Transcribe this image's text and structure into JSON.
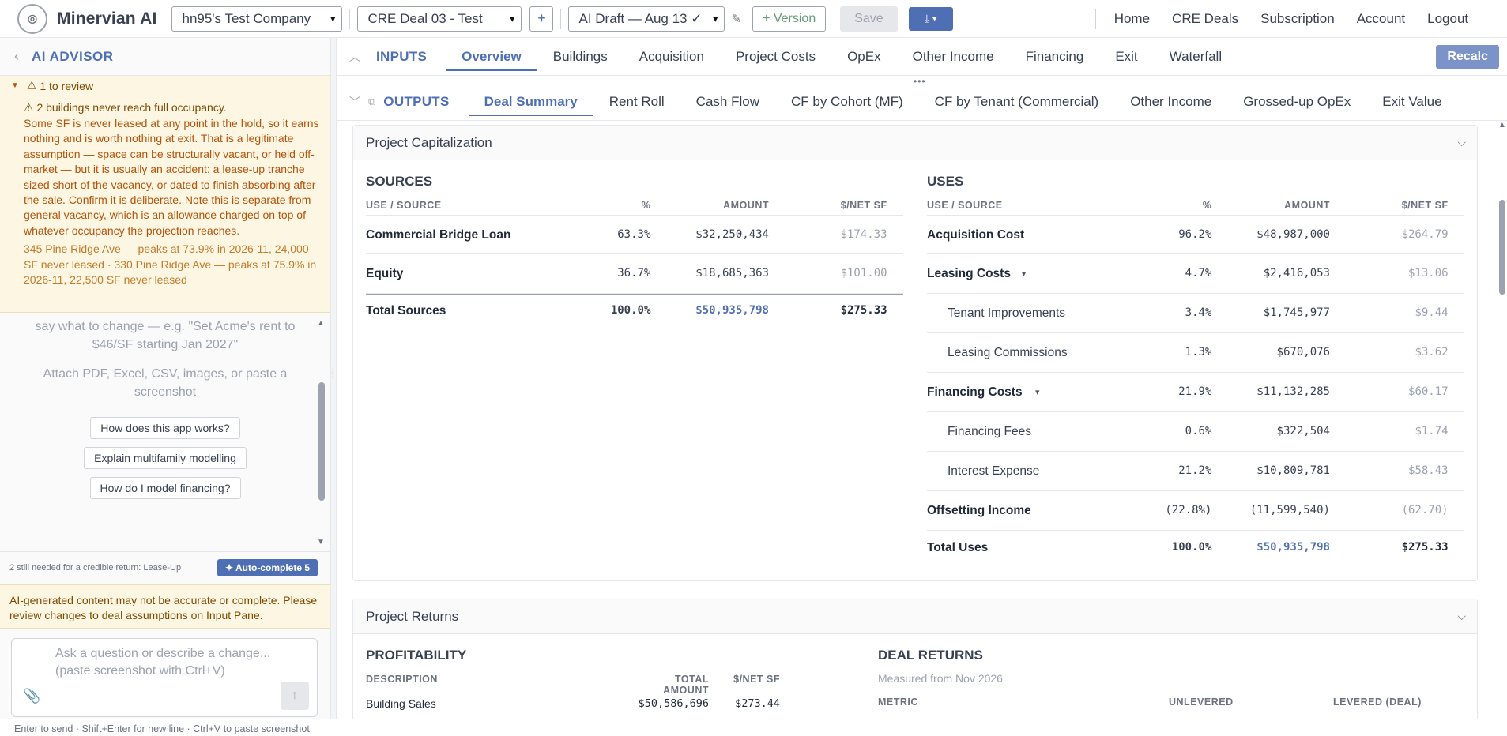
{
  "topbar": {
    "brand": "Minervian AI",
    "company": "hn95's Test Company",
    "deal": "CRE Deal 03 - Test",
    "draft": "AI Draft — Aug 13 ✓",
    "add": "+",
    "version": "+ Version",
    "save": "Save",
    "download_icon": "download-icon",
    "nav": [
      "Home",
      "CRE Deals",
      "Subscription",
      "Account",
      "Logout"
    ]
  },
  "sidebar": {
    "title": "AI ADVISOR",
    "review": "1 to review",
    "warn_title": "2 buildings never reach full occupancy.",
    "warn_body": "Some SF is never leased at any point in the hold, so it earns nothing and is worth nothing at exit. That is a legitimate assumption — space can be structurally vacant, or held off-market — but it is usually an accident: a lease-up tranche sized short of the vacancy, or dated to finish absorbing after the sale. Confirm it is deliberate. Note this is separate from general vacancy, which is an allowance charged on top of whatever occupancy the projection reaches.",
    "warn_buildings": "345 Pine Ridge Ave — peaks at 73.9% in 2026-11, 24,000 SF never leased · 330 Pine Ridge Ave — peaks at 75.9% in 2026-11, 22,500 SF never leased",
    "hint1": "say what to change — e.g. \"Set Acme's rent to $46/SF starting Jan 2027\"",
    "hint2": "Attach PDF, Excel, CSV, images, or paste a screenshot",
    "suggestions": [
      "How does this app works?",
      "Explain multifamily modelling",
      "How do I model financing?"
    ],
    "needed": "2 still needed for a credible return: Lease-Up",
    "autocomplete": "✦ Auto-complete 5",
    "disclaimer": "AI-generated content may not be accurate or complete. Please review changes to deal assumptions on Input Pane.",
    "placeholder": "Ask a question or describe a change...\n(paste screenshot with Ctrl+V)",
    "footnote": "Enter to send · Shift+Enter for new line · Ctrl+V to paste screenshot"
  },
  "inputs": {
    "label": "INPUTS",
    "tabs": [
      "Overview",
      "Buildings",
      "Acquisition",
      "Project Costs",
      "OpEx",
      "Other Income",
      "Financing",
      "Exit",
      "Waterfall"
    ],
    "active": "Overview",
    "recalc": "Recalc"
  },
  "outputs": {
    "label": "OUTPUTS",
    "tabs": [
      "Deal Summary",
      "Rent Roll",
      "Cash Flow",
      "CF by Cohort (MF)",
      "CF by Tenant (Commercial)",
      "Other Income",
      "Grossed-up OpEx",
      "Exit Value"
    ],
    "active": "Deal Summary"
  },
  "capitalization": {
    "title": "Project Capitalization",
    "sources_title": "SOURCES",
    "uses_title": "USES",
    "headers": [
      "USE / SOURCE",
      "%",
      "AMOUNT",
      "$/NET SF"
    ],
    "sources": [
      {
        "name": "Commercial Bridge Loan",
        "pct": "63.3%",
        "amt": "$32,250,434",
        "psf": "$174.33"
      },
      {
        "name": "Equity",
        "pct": "36.7%",
        "amt": "$18,685,363",
        "psf": "$101.00"
      }
    ],
    "sources_total": {
      "name": "Total Sources",
      "pct": "100.0%",
      "amt": "$50,935,798",
      "psf": "$275.33"
    },
    "uses": [
      {
        "name": "Acquisition Cost",
        "pct": "96.2%",
        "amt": "$48,987,000",
        "psf": "$264.79",
        "level": 0
      },
      {
        "name": "Leasing Costs",
        "pct": "4.7%",
        "amt": "$2,416,053",
        "psf": "$13.06",
        "level": 0,
        "caret": "▾"
      },
      {
        "name": "Tenant Improvements",
        "pct": "3.4%",
        "amt": "$1,745,977",
        "psf": "$9.44",
        "level": 1
      },
      {
        "name": "Leasing Commissions",
        "pct": "1.3%",
        "amt": "$670,076",
        "psf": "$3.62",
        "level": 1
      },
      {
        "name": "Financing Costs",
        "pct": "21.9%",
        "amt": "$11,132,285",
        "psf": "$60.17",
        "level": 0,
        "caret": "▾"
      },
      {
        "name": "Financing Fees",
        "pct": "0.6%",
        "amt": "$322,504",
        "psf": "$1.74",
        "level": 1
      },
      {
        "name": "Interest Expense",
        "pct": "21.2%",
        "amt": "$10,809,781",
        "psf": "$58.43",
        "level": 1
      },
      {
        "name": "Offsetting Income",
        "pct": "(22.8%)",
        "amt": "(11,599,540)",
        "psf": "(62.70)",
        "level": 0
      }
    ],
    "uses_total": {
      "name": "Total Uses",
      "pct": "100.0%",
      "amt": "$50,935,798",
      "psf": "$275.33"
    }
  },
  "returns": {
    "title": "Project Returns",
    "profit_title": "PROFITABILITY",
    "profit_headers": [
      "DESCRIPTION",
      "TOTAL AMOUNT",
      "$/NET SF"
    ],
    "profit_rows": [
      {
        "name": "Building Sales",
        "amt": "$50,586,696",
        "psf": "$273.44"
      }
    ],
    "deal_title": "DEAL RETURNS",
    "measured": "Measured from Nov 2026",
    "deal_headers": [
      "METRIC",
      "UNLEVERED",
      "LEVERED (DEAL)"
    ]
  }
}
